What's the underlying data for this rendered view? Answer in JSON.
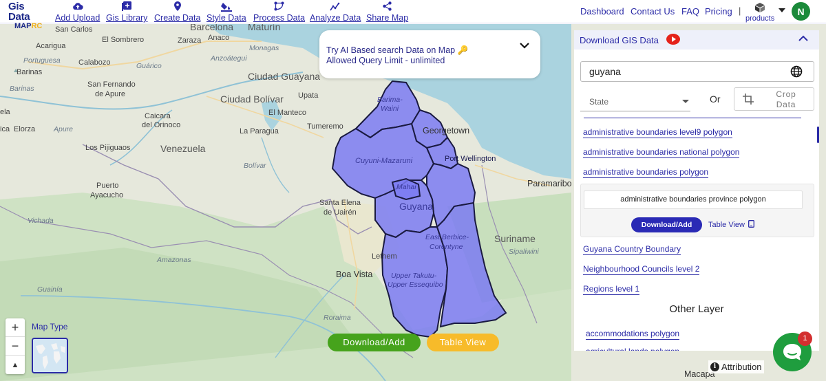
{
  "logo": {
    "line1": "Gis Data",
    "line2a": "MAP",
    "line2b": "RC"
  },
  "nav": [
    {
      "label": "Add Upload",
      "icon": "cloud-upload-icon"
    },
    {
      "label": "Gis Library",
      "icon": "library-add-icon"
    },
    {
      "label": "Create Data",
      "icon": "map-pin-icon"
    },
    {
      "label": "Style Data",
      "icon": "paint-bucket-icon"
    },
    {
      "label": "Process Data",
      "icon": "process-nodes-icon"
    },
    {
      "label": "Analyze Data",
      "icon": "analytics-icon"
    },
    {
      "label": "Share Map",
      "icon": "share-icon"
    }
  ],
  "rightnav": {
    "dashboard": "Dashboard",
    "contact": "Contact Us",
    "faq": "FAQ",
    "pricing": "Pricing",
    "separator": "|",
    "products": "products",
    "avatar": "N"
  },
  "ai_search": {
    "line1": "Try AI Based search Data on Map",
    "line2": "Allowed Query Limit - unlimited"
  },
  "panel": {
    "title": "Download GIS Data",
    "search_value": "guyana",
    "state_placeholder": "State",
    "or_label": "Or",
    "crop_label": "Crop Data",
    "layers_top": [
      "administrative boundaries level9 polygon",
      "administrative boundaries national polygon",
      "administrative boundaries polygon"
    ],
    "selected_layer": "administrative boundaries province polygon",
    "download_btn": "Download/Add",
    "table_view": "Table View",
    "layers_bottom": [
      "Guyana Country Boundary",
      "Neighbourhood Councils level 2",
      "Regions level 1"
    ],
    "other_header": "Other Layer",
    "other_layers": [
      "accommodations polygon",
      "agricultural lands polygon"
    ]
  },
  "map": {
    "places": {
      "san_carlos": "San Carlos",
      "maturin": "Maturín",
      "barcelona": "Barcelona",
      "sombrero": "El Sombrero",
      "zaraza": "Zaraza",
      "anaco": "Anaco",
      "acarigua": "Acarigua",
      "monagas": "Monagas",
      "portuguesa": "Portuguesa",
      "calabozo": "Calabozo",
      "guarico": "Guárico",
      "anzoategui": "Anzoátegui",
      "barinas_city": "Barinas",
      "ciudad_guayana": "Ciudad Guayana",
      "barinas_region": "Barinas",
      "san_fernando": "San Fernando",
      "de_apure": "de Apure",
      "ciudad_bolivar": "Ciudad Bolívar",
      "upata": "Upata",
      "manteco": "El Manteco",
      "caicara": "Caicara",
      "del_orinoco": "del Orinoco",
      "elorza": "Elorza",
      "apure": "Apure",
      "la_paragua": "La Paragua",
      "tumeremo": "Tumeremo",
      "georgetown": "Georgetown",
      "los_pijiguaos": "Los Pijiguaos",
      "venezuela": "Venezuela",
      "bolivar": "Bolívar",
      "puerto": "Puerto",
      "ayacucho": "Ayacucho",
      "paramaribo": "Paramaribo",
      "santa_elena": "Santa Elena",
      "de_uairen": "de Uairén",
      "vichada": "Vichada",
      "suriname": "Suriname",
      "sipaliwini": "Sipaliwini",
      "amazonas": "Amazonas",
      "lethem": "Lethem",
      "boa_vista": "Boa Vista",
      "guainia": "Guainía",
      "roraima": "Roraima",
      "macapa": "Macapá",
      "ela": "ela",
      "ica": "ica"
    },
    "regions": {
      "barima": "Barima-",
      "waini": "Waini",
      "cuyuni": "Cuyuni-Mazaruni",
      "mahai": "Mahai",
      "guyana": "Guyana",
      "east": "East Berbice-",
      "corentyne": "Corentyne",
      "upper": "Upper Takutu-",
      "essequibo": "Upper Essequibo",
      "port": "Port Wellington"
    }
  },
  "controls": {
    "zoom_in": "+",
    "zoom_out": "−",
    "reset": "▲",
    "map_type": "Map Type",
    "download_btn": "Download/Add",
    "table_btn": "Table View",
    "attribution": "Attribution",
    "chat_badge": "1"
  },
  "colors": {
    "brand": "#2b2ba7",
    "boundary_fill": "#7b7bf2",
    "download_green": "#46a31c",
    "table_orange": "#f7bb2a",
    "chat_green": "#1f9d3e"
  }
}
